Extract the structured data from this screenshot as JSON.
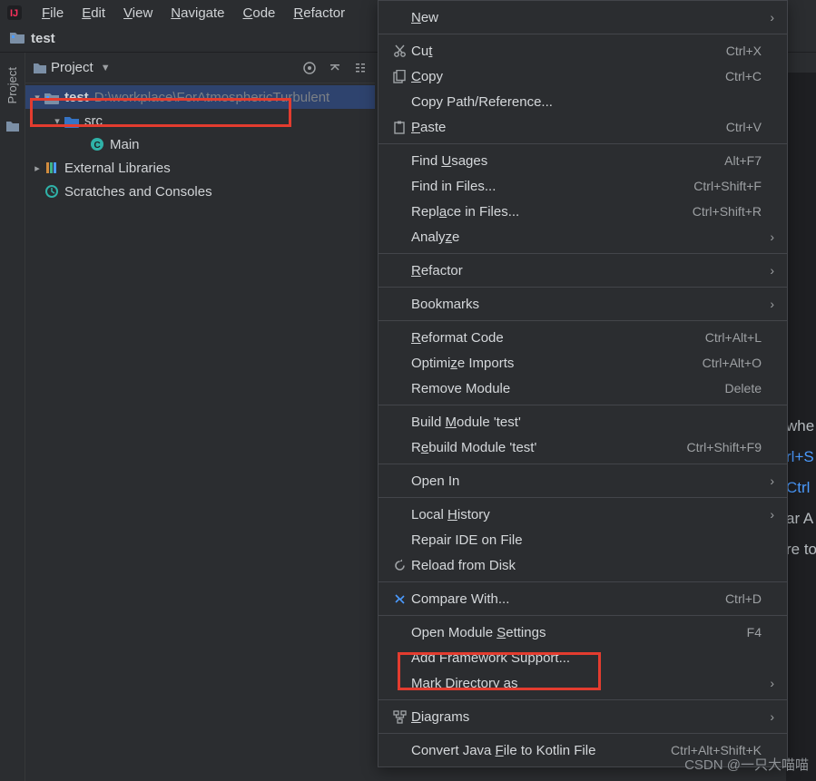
{
  "menubar": {
    "items": [
      "File",
      "Edit",
      "View",
      "Navigate",
      "Code",
      "Refactor"
    ]
  },
  "breadcrumb": {
    "label": "test"
  },
  "gutter": {
    "label": "Project"
  },
  "project_header": {
    "title": "Project"
  },
  "project_tree": {
    "root": {
      "name": "test",
      "path": "D:\\workplace\\ForAtmosphericTurbulent"
    },
    "src": {
      "name": "src"
    },
    "main": {
      "name": "Main"
    },
    "ext": {
      "name": "External Libraries"
    },
    "scratch": {
      "name": "Scratches and Consoles"
    }
  },
  "context_menu": [
    {
      "label_html": "<span class='u'>N</span>ew",
      "submenu": true
    },
    "---",
    {
      "icon": "cut-icon",
      "label_html": "Cu<span class='u'>t</span>",
      "shortcut": "Ctrl+X"
    },
    {
      "icon": "copy-icon",
      "label_html": "<span class='u'>C</span>opy",
      "shortcut": "Ctrl+C"
    },
    {
      "label_html": "Copy Path/Reference..."
    },
    {
      "icon": "paste-icon",
      "label_html": "<span class='u'>P</span>aste",
      "shortcut": "Ctrl+V"
    },
    "---",
    {
      "label_html": "Find <span class='u'>U</span>sages",
      "shortcut": "Alt+F7"
    },
    {
      "label_html": "Find in Files...",
      "shortcut": "Ctrl+Shift+F"
    },
    {
      "label_html": "Repl<span class='u'>a</span>ce in Files...",
      "shortcut": "Ctrl+Shift+R"
    },
    {
      "label_html": "Analy<span class='u'>z</span>e",
      "submenu": true
    },
    "---",
    {
      "label_html": "<span class='u'>R</span>efactor",
      "submenu": true
    },
    "---",
    {
      "label_html": "Bookmarks",
      "submenu": true
    },
    "---",
    {
      "label_html": "<span class='u'>R</span>eformat Code",
      "shortcut": "Ctrl+Alt+L"
    },
    {
      "label_html": "Optimi<span class='u'>z</span>e Imports",
      "shortcut": "Ctrl+Alt+O"
    },
    {
      "label_html": "Remove Module",
      "shortcut": "Delete"
    },
    "---",
    {
      "label_html": "Build <span class='u'>M</span>odule 'test'"
    },
    {
      "label_html": "R<span class='u'>e</span>build Module 'test'",
      "shortcut": "Ctrl+Shift+F9"
    },
    "---",
    {
      "label_html": "Open In",
      "submenu": true
    },
    "---",
    {
      "label_html": "Local <span class='u'>H</span>istory",
      "submenu": true
    },
    {
      "label_html": "Repair IDE on File"
    },
    {
      "icon": "reload-icon",
      "label_html": "Reload from Disk"
    },
    "---",
    {
      "icon": "compare-icon",
      "label_html": "Compare With...",
      "shortcut": "Ctrl+D"
    },
    "---",
    {
      "label_html": "Open Module <span class='u'>S</span>ettings",
      "shortcut": "F4"
    },
    {
      "label_html": "Add Framework Support..."
    },
    {
      "label_html": "Mark Directory as",
      "submenu": true
    },
    "---",
    {
      "icon": "diagram-icon",
      "label_html": "<span class='u'>D</span>iagrams",
      "submenu": true
    },
    "---",
    {
      "label_html": "Convert Java <span class='u'>F</span>ile to Kotlin File",
      "shortcut": "Ctrl+Alt+Shift+K"
    }
  ],
  "editor_fragments": [
    "whe",
    "rl+S",
    "Ctrl",
    "ar  A",
    "re to"
  ],
  "watermark": "CSDN @一只大喵喵"
}
